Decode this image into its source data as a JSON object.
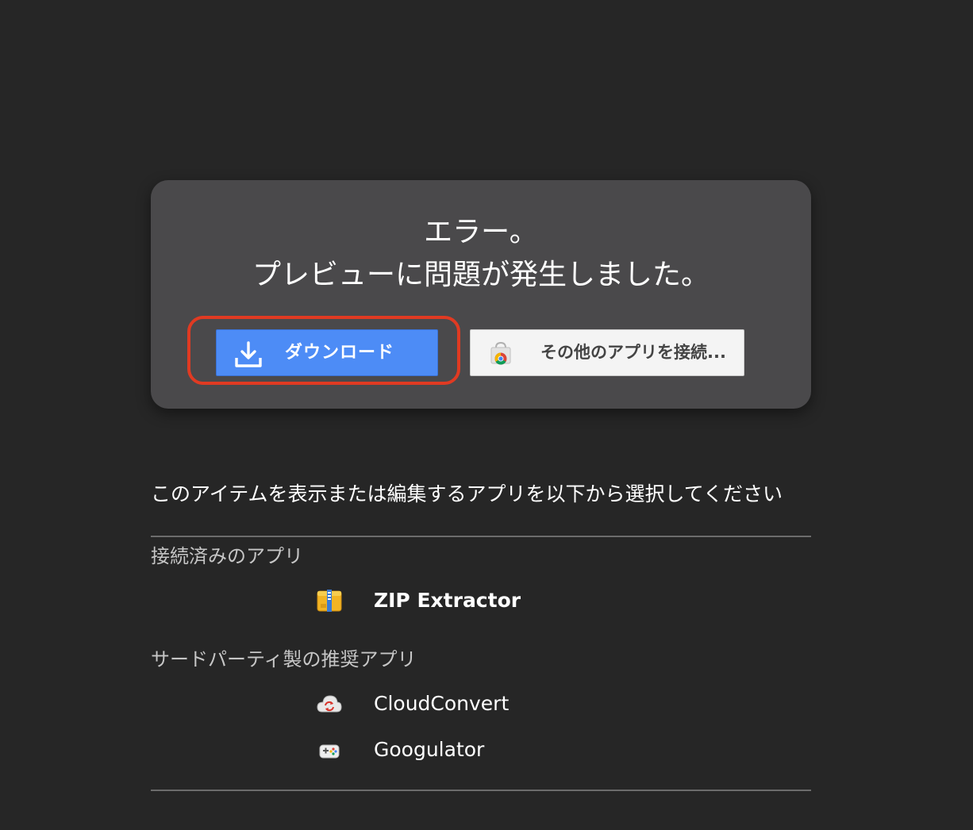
{
  "error": {
    "title": "エラー。",
    "message": "プレビューに問題が発生しました。"
  },
  "buttons": {
    "download_label": "ダウンロード",
    "download_icon": "download-icon",
    "other_apps_label": "その他のアプリを接続...",
    "other_apps_icon": "chrome-web-store-icon"
  },
  "colors": {
    "background": "#262626",
    "card": "#4a494b",
    "accent_blue": "#4d8cf6",
    "highlight_red": "#e03a22"
  },
  "apps": {
    "instruction": "このアイテムを表示または編集するアプリを以下から選択してください",
    "connected_heading": "接続済みのアプリ",
    "connected": [
      {
        "name": "ZIP Extractor",
        "icon": "zip-archive-icon"
      }
    ],
    "suggested_heading": "サードパーティ製の推奨アプリ",
    "suggested": [
      {
        "name": "CloudConvert",
        "icon": "cloud-convert-icon"
      },
      {
        "name": "Googulator",
        "icon": "gamepad-icon"
      }
    ]
  }
}
